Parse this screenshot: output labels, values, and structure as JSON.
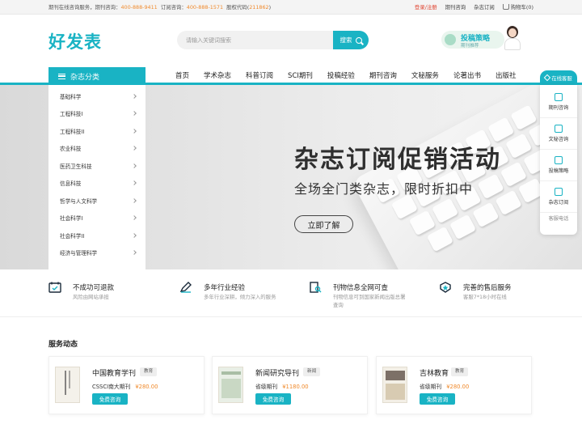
{
  "topbar": {
    "service_text": "期刊在线咨询服务，期刊咨询：",
    "phone1": "400-888-9411",
    "order_label": "订阅咨询：",
    "phone2": "400-888-1571",
    "stock_label": "股权代码(",
    "stock_code": "211862",
    "stock_end": ")",
    "login": "登录/注册",
    "links": [
      "期刊咨询",
      "杂志订阅"
    ],
    "cart": "购物车(0)"
  },
  "header": {
    "logo": "好发表",
    "search_placeholder": "请输入关键词搜索",
    "search_button": "搜索",
    "promo_title": "投稿策略",
    "promo_sub": "期刊推荐"
  },
  "nav": {
    "category_label": "杂志分类",
    "items": [
      "首页",
      "学术杂志",
      "科普订阅",
      "SCI期刊",
      "投稿经验",
      "期刊咨询",
      "文秘服务",
      "论著出书",
      "出版社"
    ]
  },
  "categories": [
    "基础科学",
    "工程科技I",
    "工程科技II",
    "农业科技",
    "医药卫生科技",
    "信息科技",
    "哲学与人文科学",
    "社会科学I",
    "社会科学II",
    "经济与管理科学"
  ],
  "banner": {
    "title": "杂志订阅促销活动",
    "subtitle": "全场全门类杂志，限时折扣中",
    "cta": "立即了解"
  },
  "float_panel": {
    "head": "在线客服",
    "items": [
      "期刊咨询",
      "文秘咨询",
      "投稿策略",
      "杂志订阅"
    ],
    "phone_label": "客服电话"
  },
  "features": [
    {
      "title": "不成功可退款",
      "desc": "风险由网站承担"
    },
    {
      "title": "多年行业经验",
      "desc": "多年行业深耕，倾力深入的服务"
    },
    {
      "title": "刊物信息全网可查",
      "desc": "刊物信息可到国家新闻出版总署查询"
    },
    {
      "title": "完善的售后服务",
      "desc": "客服7*18小时在线"
    }
  ],
  "service": {
    "title": "服务动态",
    "cards": [
      {
        "name": "中国教育学刊",
        "tag": "教育",
        "level": "CSSCI南大期刊",
        "price": "¥280.00",
        "button": "免费咨询"
      },
      {
        "name": "新闻研究导刊",
        "tag": "新闻",
        "level": "省级期刊",
        "price": "¥1180.00",
        "button": "免费咨询"
      },
      {
        "name": "吉林教育",
        "tag": "教育",
        "level": "省级期刊",
        "price": "¥280.00",
        "button": "免费咨询"
      }
    ]
  },
  "colors": {
    "accent": "#19b3c4",
    "price": "#f08a2c",
    "login": "#e0432f"
  }
}
